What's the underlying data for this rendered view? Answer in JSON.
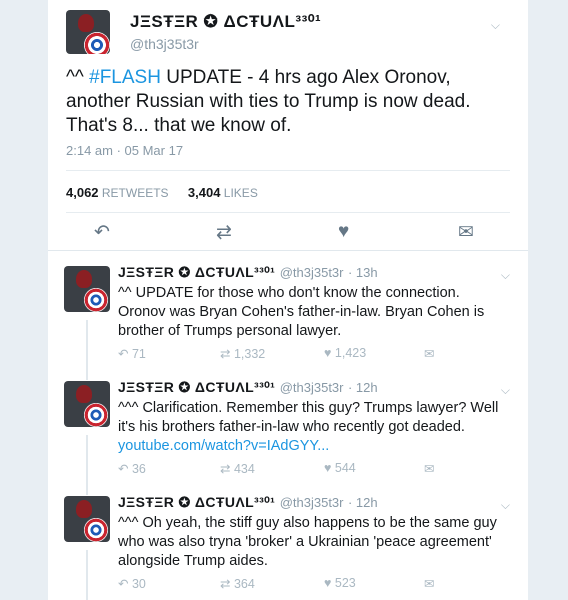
{
  "main_tweet": {
    "name": "JΞSŦΞR ✪ ΔCŦUΛL³³⁰¹",
    "handle": "@th3j35t3r",
    "text_prefix": "^^ ",
    "hashtag": "#FLASH",
    "text_rest": " UPDATE - 4 hrs ago Alex Oronov, another Russian with ties to Trump is now dead. That's 8... that we know of.",
    "timestamp": "2:14 am · 05 Mar 17",
    "retweets_count": "4,062",
    "retweets_label": "RETWEETS",
    "likes_count": "3,404",
    "likes_label": "LIKES",
    "icons": {
      "reply": "reply-icon",
      "retweet": "retweet-icon",
      "like": "heart-icon",
      "dm": "message-icon",
      "menu": "chevron-down-icon"
    }
  },
  "replies": [
    {
      "name": "JΞSŦΞR ✪ ΔCŦUΛL³³⁰¹",
      "handle": "@th3j35t3r",
      "time": "· 13h",
      "text": "^^ UPDATE for those who don't know the connection. Oronov was Bryan Cohen's father-in-law. Bryan Cohen is brother of Trumps personal lawyer.",
      "link": "",
      "replies": "71",
      "retweets": "1,332",
      "likes": "1,423"
    },
    {
      "name": "JΞSŦΞR ✪ ΔCŦUΛL³³⁰¹",
      "handle": "@th3j35t3r",
      "time": "· 12h",
      "text": "^^^ Clarification. Remember this guy? Trumps lawyer? Well it's his brothers father-in-law who recently got deaded.",
      "link": "youtube.com/watch?v=IAdGYY...",
      "replies": "36",
      "retweets": "434",
      "likes": "544"
    },
    {
      "name": "JΞSŦΞR ✪ ΔCŦUΛL³³⁰¹",
      "handle": "@th3j35t3r",
      "time": "· 12h",
      "text": "^^^ Oh yeah, the stiff guy also happens to be the same guy who was also tryna 'broker' a Ukrainian 'peace agreement' alongside Trump aides.",
      "link": "",
      "replies": "30",
      "retweets": "364",
      "likes": "523"
    }
  ],
  "colors": {
    "link": "#1b95e0",
    "muted": "#8899a6",
    "text": "#14171a",
    "background": "#e8eef3"
  }
}
